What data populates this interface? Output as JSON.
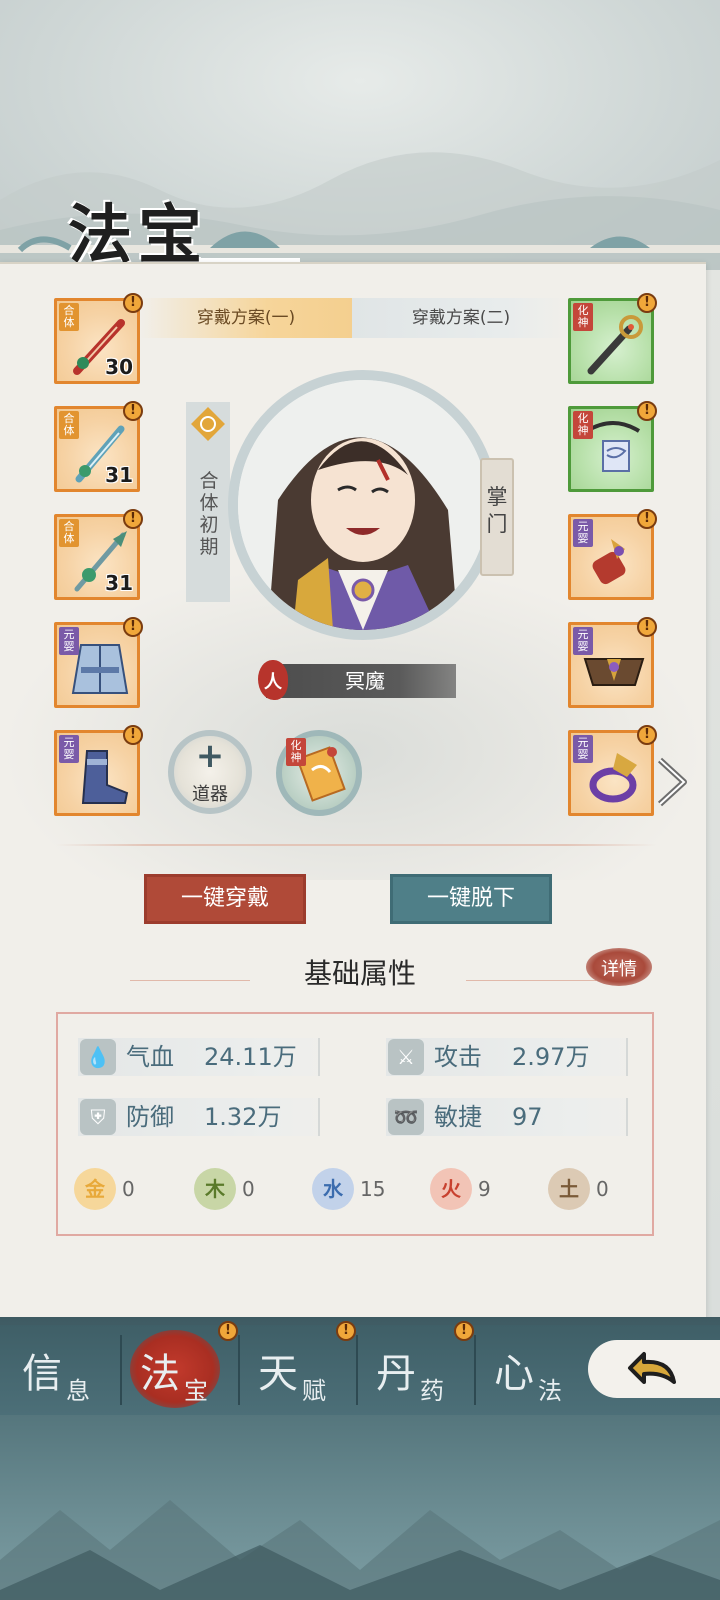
{
  "screen_title": "法宝",
  "tabs": [
    {
      "label": "穿戴方案(一)",
      "active": true
    },
    {
      "label": "穿戴方案(二)",
      "active": false
    }
  ],
  "left_slots": [
    {
      "rank": "合体",
      "level": "30",
      "alert": "!",
      "icon": "sword-icon"
    },
    {
      "rank": "合体",
      "level": "31",
      "alert": "!",
      "icon": "blade-icon"
    },
    {
      "rank": "合体",
      "level": "31",
      "alert": "!",
      "icon": "spear-icon"
    },
    {
      "rank": "元婴",
      "level": "",
      "alert": "!",
      "icon": "robe-icon"
    },
    {
      "rank": "元婴",
      "level": "",
      "alert": "!",
      "icon": "boots-icon"
    }
  ],
  "right_slots": [
    {
      "rank": "化神",
      "alert": "!",
      "icon": "staff-icon"
    },
    {
      "rank": "化神",
      "alert": "!",
      "icon": "pendant-icon"
    },
    {
      "rank": "元婴",
      "alert": "!",
      "icon": "bracer-icon"
    },
    {
      "rank": "元婴",
      "alert": "!",
      "icon": "belt-icon"
    },
    {
      "rank": "元婴",
      "alert": "!",
      "icon": "ring-icon"
    }
  ],
  "character": {
    "realm": "合体初期",
    "sect_role": "掌门",
    "race": "人",
    "name": "冥魔"
  },
  "extra": {
    "tool_plus": "+",
    "tool_label": "道器",
    "talisman_rank": "化神"
  },
  "buttons": {
    "equip_all": "一键穿戴",
    "unequip_all": "一键脱下",
    "details": "详情"
  },
  "attributes": {
    "title": "基础属性",
    "stats": [
      {
        "label": "气血",
        "value": "24.11万",
        "icon": "blood-icon"
      },
      {
        "label": "攻击",
        "value": "2.97万",
        "icon": "attack-icon"
      },
      {
        "label": "防御",
        "value": "1.32万",
        "icon": "defense-icon"
      },
      {
        "label": "敏捷",
        "value": "97",
        "icon": "agility-icon"
      }
    ],
    "elements": [
      {
        "glyph": "金",
        "value": "0",
        "color": "#e8a93a"
      },
      {
        "glyph": "木",
        "value": "0",
        "color": "#6a8a3a"
      },
      {
        "glyph": "水",
        "value": "15",
        "color": "#3b6cae"
      },
      {
        "glyph": "火",
        "value": "9",
        "color": "#c8412f"
      },
      {
        "glyph": "土",
        "value": "0",
        "color": "#8a6a48"
      }
    ]
  },
  "bottom_nav": [
    {
      "big": "信",
      "small": "息",
      "active": false,
      "alert": ""
    },
    {
      "big": "法",
      "small": "宝",
      "active": true,
      "alert": "!"
    },
    {
      "big": "天",
      "small": "赋",
      "active": false,
      "alert": "!"
    },
    {
      "big": "丹",
      "small": "药",
      "active": false,
      "alert": "!"
    },
    {
      "big": "心",
      "small": "法",
      "active": false,
      "alert": ""
    }
  ],
  "colors": {
    "accent_red": "#b04a38",
    "accent_teal": "#4f7f88",
    "slot_orange": "#e2862e",
    "slot_green": "#4e9a3a",
    "stat_text": "#4a6c7c"
  }
}
